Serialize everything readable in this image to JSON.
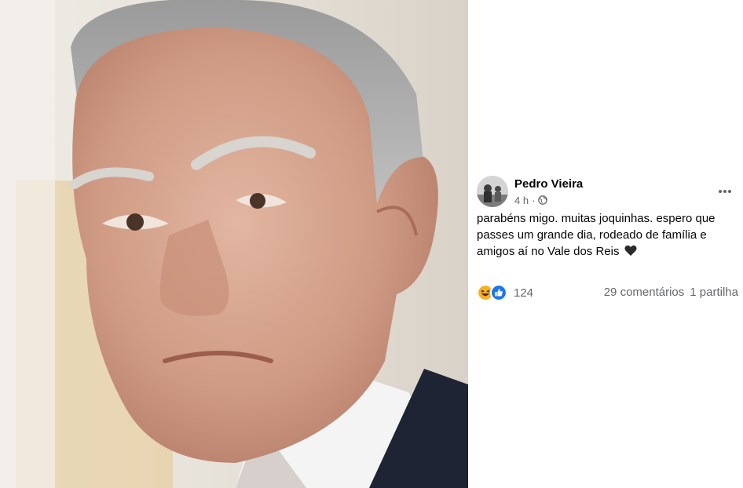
{
  "post": {
    "author": "Pedro Vieira",
    "time": "4 h",
    "separator": "·",
    "audience_icon": "globe-icon",
    "text": "parabéns migo. muitas joquinhas. espero que passes um grande dia, rodeado de família e amigos aí no Vale dos Reis",
    "trailing_emoji": "black-heart-icon",
    "more_icon": "more-horizontal-icon"
  },
  "stats": {
    "reaction_icons": [
      "haha-icon",
      "like-icon"
    ],
    "reaction_count": "124",
    "comments": "29 comentários",
    "shares": "1 partilha"
  },
  "colors": {
    "text_primary": "#050505",
    "text_secondary": "#65676b",
    "like_blue": "#1877f2",
    "haha_yellow": "#f7b125"
  }
}
